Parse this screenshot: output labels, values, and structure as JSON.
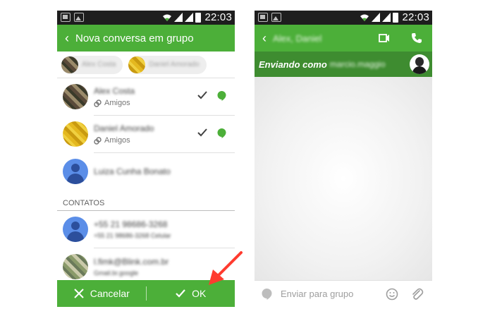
{
  "status_bar": {
    "time": "22:03"
  },
  "left": {
    "title": "Nova conversa em grupo",
    "chips": [
      {
        "name": "Alex Costa"
      },
      {
        "name": "Daniel Amorado"
      }
    ],
    "contacts": [
      {
        "name": "Alex Costa",
        "subtitle": "Amigos",
        "checked": true
      },
      {
        "name": "Daniel Amorado",
        "subtitle": "Amigos",
        "checked": true
      },
      {
        "name": "Luiza Cunha Bonato",
        "subtitle": "",
        "checked": false
      }
    ],
    "section_label": "CONTATOS",
    "contacts2": [
      {
        "line1": "+55 21 98686-3268",
        "line2": "+55 21 98686-3268 Celular"
      },
      {
        "line1": "l.fimk@Blink.com.br",
        "line2": "Gmail.br.google"
      }
    ],
    "cancel_label": "Cancelar",
    "ok_label": "OK"
  },
  "right": {
    "title": "Alex, Daniel",
    "sending_label": "Enviando como",
    "sending_name": "marcio.maggio",
    "composer_placeholder": "Enviar para grupo"
  },
  "colors": {
    "accent": "#4caf39",
    "accent_dark": "#3e8c30",
    "arrow": "#ff3b2f"
  }
}
